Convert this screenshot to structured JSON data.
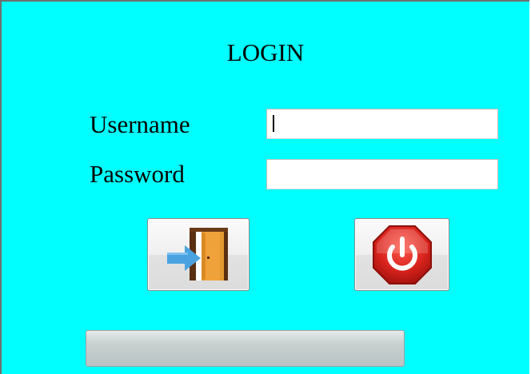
{
  "login_form": {
    "title": "LOGIN",
    "username_label": "Username",
    "password_label": "Password",
    "username_value": "",
    "password_value": ""
  },
  "buttons": {
    "login_icon": "door-enter-icon",
    "exit_icon": "power-stop-icon"
  },
  "progress": {
    "value": 0
  },
  "colors": {
    "background": "#00ffff",
    "stop_red": "#d8231c",
    "door_orange": "#f0a23a",
    "arrow_blue": "#4aa3e0"
  }
}
